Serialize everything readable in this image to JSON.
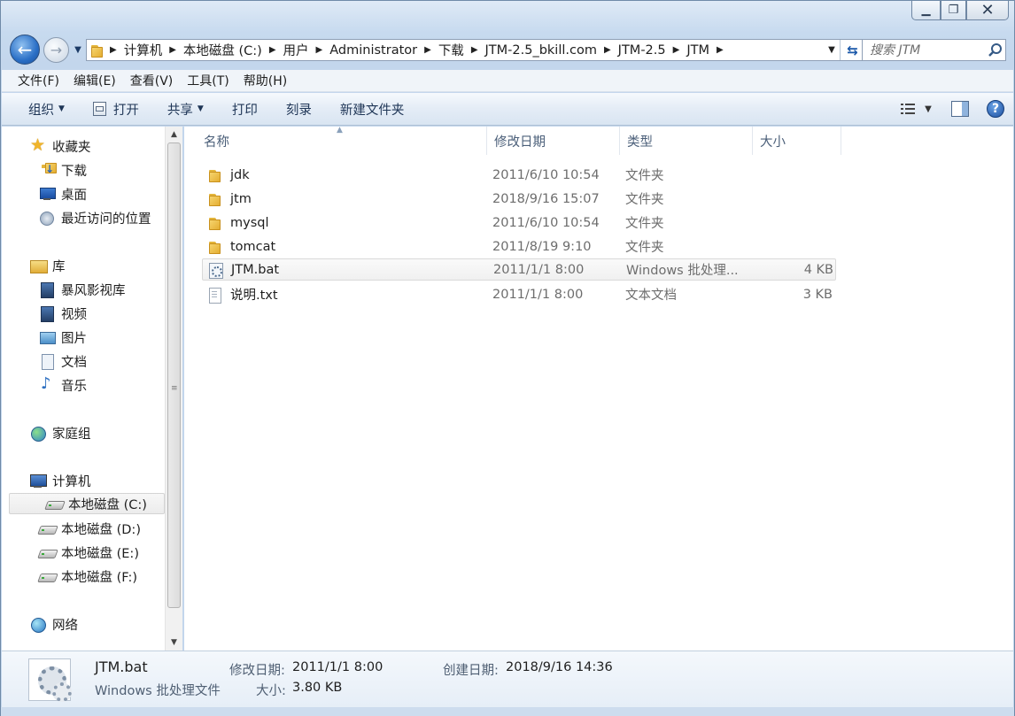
{
  "breadcrumbs": [
    "计算机",
    "本地磁盘 (C:)",
    "用户",
    "Administrator",
    "下载",
    "JTM-2.5_bkill.com",
    "JTM-2.5",
    "JTM"
  ],
  "search": {
    "placeholder": "搜索 JTM"
  },
  "menu": [
    "文件(F)",
    "编辑(E)",
    "查看(V)",
    "工具(T)",
    "帮助(H)"
  ],
  "commands": {
    "organize": "组织",
    "open": "打开",
    "share": "共享",
    "print": "打印",
    "burn": "刻录",
    "new_folder": "新建文件夹"
  },
  "nav": {
    "favorites": "收藏夹",
    "downloads": "下载",
    "desktop": "桌面",
    "recent": "最近访问的位置",
    "libraries": "库",
    "storm_video": "暴风影视库",
    "videos": "视频",
    "pictures": "图片",
    "documents": "文档",
    "music": "音乐",
    "homegroup": "家庭组",
    "computer": "计算机",
    "drive_c": "本地磁盘 (C:)",
    "drive_d": "本地磁盘 (D:)",
    "drive_e": "本地磁盘 (E:)",
    "drive_f": "本地磁盘 (F:)",
    "network": "网络"
  },
  "columns": {
    "name": "名称",
    "modified": "修改日期",
    "type": "类型",
    "size": "大小"
  },
  "files": [
    {
      "name": "jdk",
      "modified": "2011/6/10 10:54",
      "type": "文件夹",
      "size": "",
      "icon": "folder-icon"
    },
    {
      "name": "jtm",
      "modified": "2018/9/16 15:07",
      "type": "文件夹",
      "size": "",
      "icon": "folder-icon"
    },
    {
      "name": "mysql",
      "modified": "2011/6/10 10:54",
      "type": "文件夹",
      "size": "",
      "icon": "folder-icon"
    },
    {
      "name": "tomcat",
      "modified": "2011/8/19 9:10",
      "type": "文件夹",
      "size": "",
      "icon": "folder-icon"
    },
    {
      "name": "JTM.bat",
      "modified": "2011/1/1 8:00",
      "type": "Windows 批处理...",
      "size": "4 KB",
      "icon": "batch-file-icon"
    },
    {
      "name": "说明.txt",
      "modified": "2011/1/1 8:00",
      "type": "文本文档",
      "size": "3 KB",
      "icon": "text-file-icon"
    }
  ],
  "details": {
    "name": "JTM.bat",
    "type": "Windows 批处理文件",
    "modified_label": "修改日期:",
    "modified_value": "2011/1/1 8:00",
    "created_label": "创建日期:",
    "created_value": "2018/9/16 14:36",
    "size_label": "大小:",
    "size_value": "3.80 KB"
  }
}
